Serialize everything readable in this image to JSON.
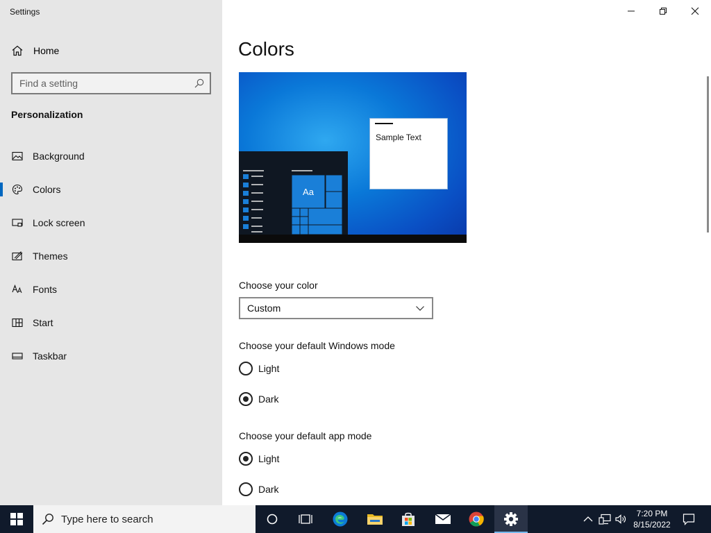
{
  "app": {
    "title": "Settings"
  },
  "sidebar": {
    "home_label": "Home",
    "search_placeholder": "Find a setting",
    "section_title": "Personalization",
    "items": [
      {
        "label": "Background",
        "icon": "picture-icon"
      },
      {
        "label": "Colors",
        "icon": "palette-icon",
        "active": true
      },
      {
        "label": "Lock screen",
        "icon": "lock-screen-icon"
      },
      {
        "label": "Themes",
        "icon": "themes-icon"
      },
      {
        "label": "Fonts",
        "icon": "fonts-icon"
      },
      {
        "label": "Start",
        "icon": "start-icon"
      },
      {
        "label": "Taskbar",
        "icon": "taskbar-icon"
      }
    ]
  },
  "main": {
    "page_title": "Colors",
    "preview": {
      "sample_text": "Sample Text",
      "tile_text": "Aa"
    },
    "choose_color": {
      "label": "Choose your color",
      "selected": "Custom"
    },
    "windows_mode": {
      "label": "Choose your default Windows mode",
      "options": [
        {
          "label": "Light",
          "checked": false
        },
        {
          "label": "Dark",
          "checked": true
        }
      ]
    },
    "app_mode": {
      "label": "Choose your default app mode",
      "options": [
        {
          "label": "Light",
          "checked": true
        },
        {
          "label": "Dark",
          "checked": false
        }
      ]
    }
  },
  "taskbar": {
    "search_placeholder": "Type here to search",
    "time": "7:20 PM",
    "date": "8/15/2022"
  },
  "colors": {
    "accent": "#0067c0",
    "sidebar_bg": "#e6e6e6",
    "taskbar_bg": "#101a2b"
  }
}
